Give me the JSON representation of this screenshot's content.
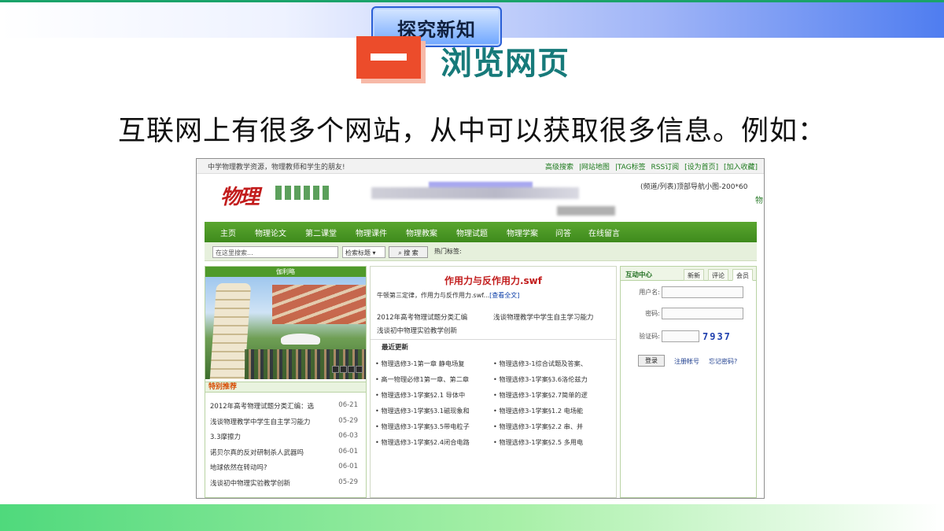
{
  "slide": {
    "badge": "探究新知",
    "section_number": "一",
    "section_title": "浏览网页",
    "lead_text": "互联网上有很多个网站，从中可以获取很多信息。例如："
  },
  "site": {
    "tagline": "中学物理教学资源，物理教师和学生的朋友!",
    "top_links": [
      "高级搜索",
      "|网站地图",
      "|TAG标签",
      "RSS订阅",
      "[设为首页]",
      "[加入收藏]"
    ],
    "logo": "物理",
    "ad_note": "(频道/列表)顶部导航小图-200*60",
    "side_char": "物",
    "nav": [
      "主页",
      "物理论文",
      "第二课堂",
      "物理课件",
      "物理教案",
      "物理试题",
      "物理学案",
      "问答",
      "在线留言"
    ],
    "search": {
      "placeholder": "在这里搜索...",
      "select_value": "检索标题",
      "button": "搜 索",
      "hot_tags_label": "热门标签:"
    },
    "left": {
      "header": "伽利略",
      "recommend_header": "特别推荐",
      "items": [
        {
          "title": "2012年高考物理试题分类汇编：选",
          "date": "06-21"
        },
        {
          "title": "浅谈物理教学中学生自主学习能力",
          "date": "05-29"
        },
        {
          "title": "3.3摩擦力",
          "date": "06-03"
        },
        {
          "title": "诺贝尔真的反对研制杀人武器吗",
          "date": "06-01"
        },
        {
          "title": "地球依然在转动吗?",
          "date": "06-01"
        },
        {
          "title": "浅谈初中物理实验教学创新",
          "date": "05-29"
        }
      ]
    },
    "center": {
      "article_title": "作用力与反作用力.swf",
      "article_desc": "牛顿第三定律，作用力与反作用力.swf...",
      "read_more": "[查看全文]",
      "related": [
        "2012年高考物理试题分类汇编",
        "浅谈物理教学中学生自主学习能力",
        "浅谈初中物理实验教学创新"
      ],
      "latest_label": "最近更新",
      "latest": [
        "• 物理选修3-1第一章 静电场复",
        "• 物理选修3-1综合试题及答案、",
        "• 高一物理必修1第一章、第二章",
        "• 物理选修3-1学案§3.6洛伦兹力",
        "• 物理选修3-1学案§2.1 导体中",
        "• 物理选修3-1学案§2.7简单的逻",
        "• 物理选修3-1学案§3.1磁现象和",
        "• 物理选修3-1学案§1.2 电场能",
        "• 物理选修3-1学案§3.5带电粒子",
        "• 物理选修3-1学案§2.2 串、并",
        "• 物理选修3-1学案§2.4闭合电路",
        "• 物理选修3-1学案§2.5 多用电"
      ]
    },
    "right": {
      "title": "互动中心",
      "tabs": [
        "新新",
        "评论",
        "会员"
      ],
      "username_label": "用户名:",
      "password_label": "密码:",
      "captcha_label": "验证码:",
      "captcha": "7937",
      "login": "登录",
      "register": "注册帐号",
      "forgot": "忘记密码?"
    }
  }
}
